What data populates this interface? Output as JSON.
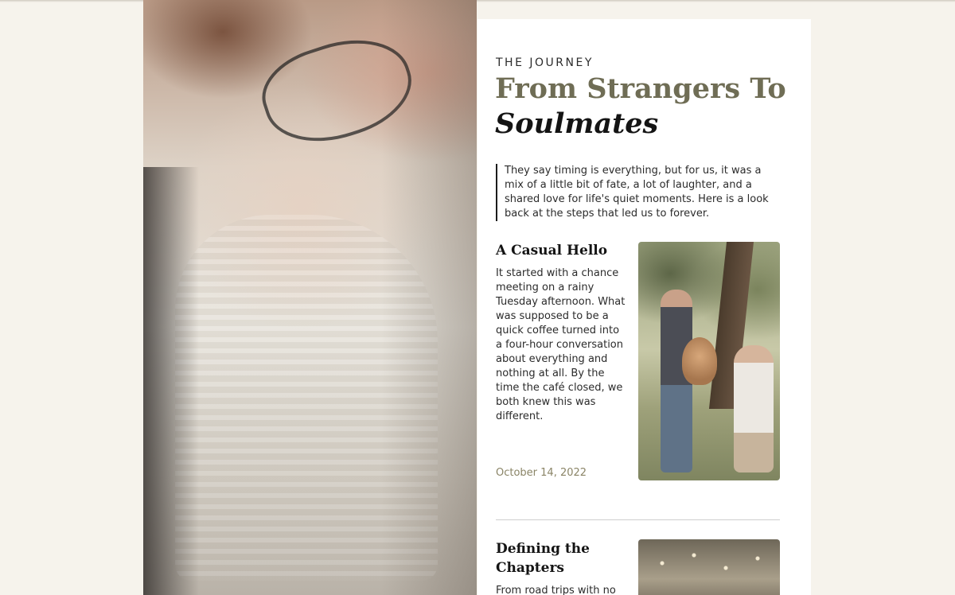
{
  "section": {
    "eyebrow": "THE JOURNEY",
    "headline_line1": "From Strangers To",
    "headline_line2": "Soulmates",
    "intro": "They say timing is everything, but for us, it was a mix of a little bit of fate, a lot of laughter, and a shared love for life's quiet moments. Here is a look back at the steps that led us to forever."
  },
  "stories": [
    {
      "title": "A Casual Hello",
      "body": "It started with a chance meeting on a rainy Tuesday afternoon. What was supposed to be a quick coffee turned into a four-hour conversation about everything and nothing at all. By the time the café closed, we both knew this was different.",
      "date": "October 14, 2022"
    },
    {
      "title": "Defining the Chapters",
      "body": "From road trips with no destination to quiet"
    }
  ],
  "colors": {
    "page_background": "#f6f3ec",
    "headline_accent": "#6f6d55",
    "date_text": "#8a8466"
  }
}
